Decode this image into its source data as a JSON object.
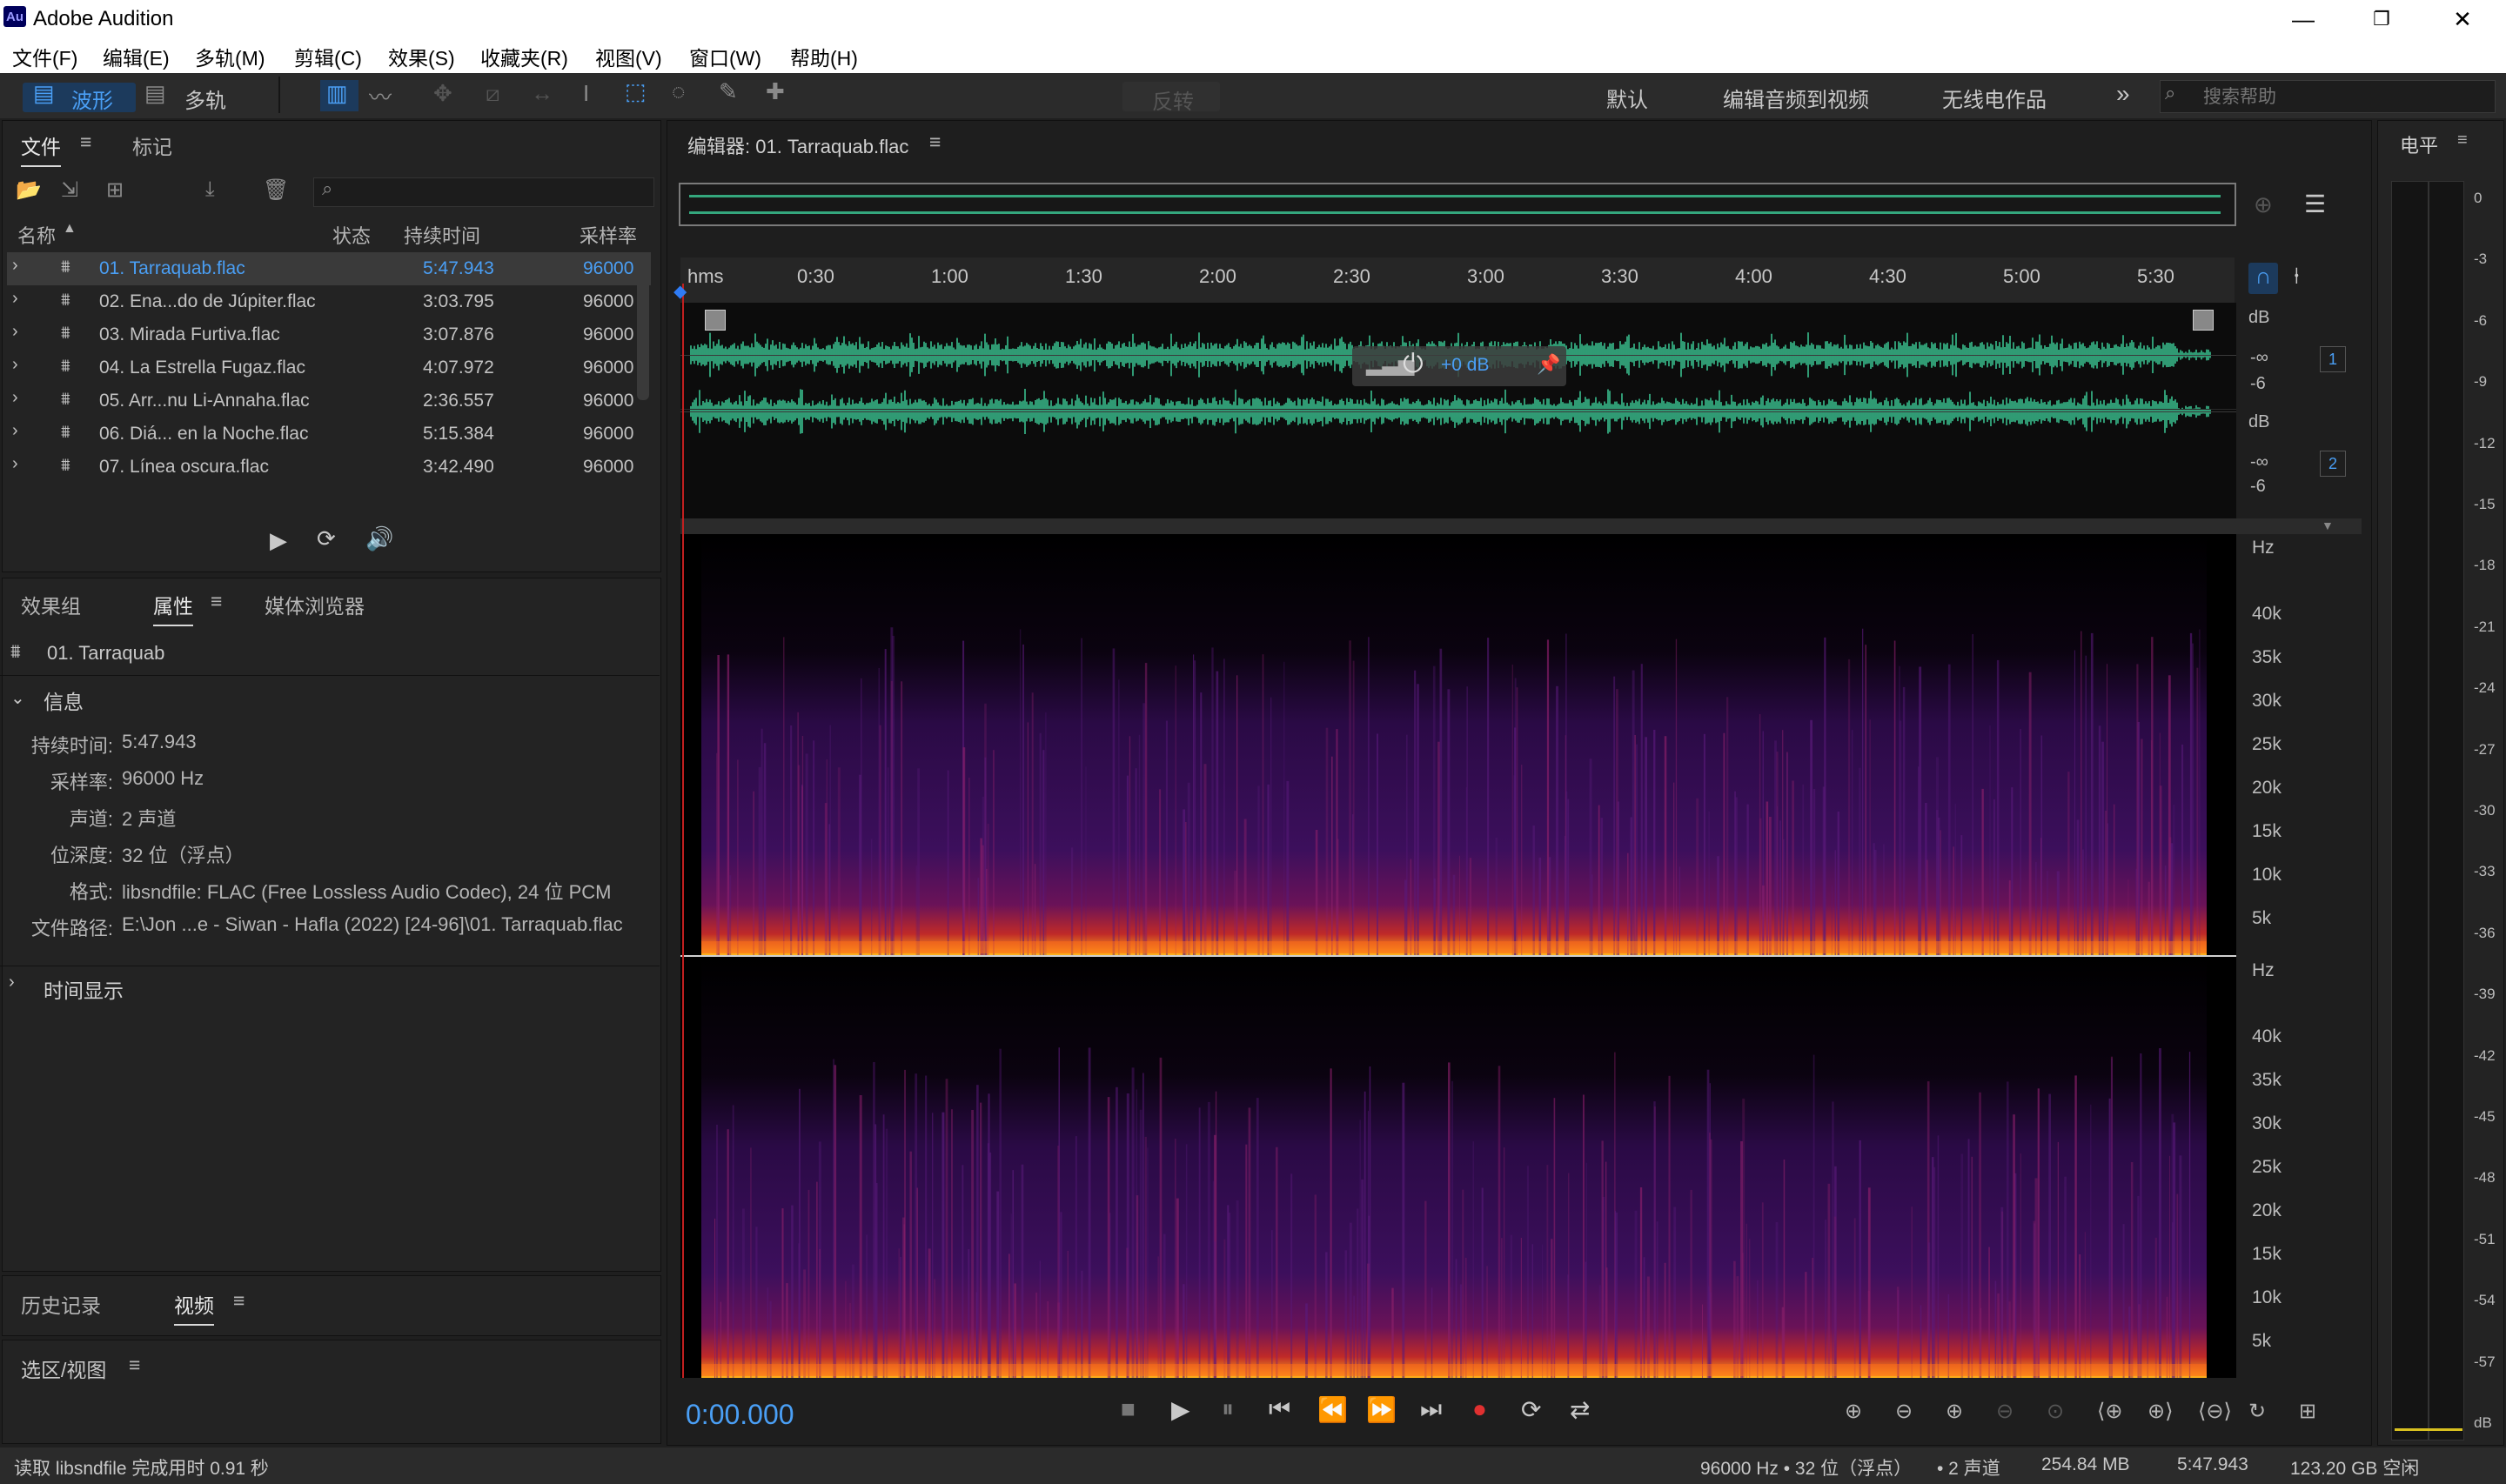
{
  "app": {
    "logo": "Au",
    "title": "Adobe Audition"
  },
  "window_controls": {
    "minimize": "—",
    "restore": "❐",
    "close": "✕"
  },
  "menu": [
    "文件(F)",
    "编辑(E)",
    "多轨(M)",
    "剪辑(C)",
    "效果(S)",
    "收藏夹(R)",
    "视图(V)",
    "窗口(W)",
    "帮助(H)"
  ],
  "toolbar": {
    "waveform_label": "波形",
    "multitrack_label": "多轨",
    "invert_label": "反转",
    "workspaces": [
      "默认",
      "编辑音频到视频",
      "无线电作品"
    ],
    "more": "»",
    "search_placeholder": "搜索帮助"
  },
  "files_panel": {
    "tabs": [
      "文件",
      "标记"
    ],
    "columns": {
      "name": "名称",
      "status": "状态",
      "duration": "持续时间",
      "rate": "采样率"
    },
    "rows": [
      {
        "name": "01. Tarraquab.flac",
        "duration": "5:47.943",
        "rate": "96000"
      },
      {
        "name": "02. Ena...do de Júpiter.flac",
        "duration": "3:03.795",
        "rate": "96000"
      },
      {
        "name": "03. Mirada Furtiva.flac",
        "duration": "3:07.876",
        "rate": "96000"
      },
      {
        "name": "04. La Estrella Fugaz.flac",
        "duration": "4:07.972",
        "rate": "96000"
      },
      {
        "name": "05. Arr...nu Li-Annaha.flac",
        "duration": "2:36.557",
        "rate": "96000"
      },
      {
        "name": "06. Diá... en la Noche.flac",
        "duration": "5:15.384",
        "rate": "96000"
      },
      {
        "name": "07. Línea oscura.flac",
        "duration": "3:42.490",
        "rate": "96000"
      }
    ]
  },
  "props_panel": {
    "tabs": [
      "效果组",
      "属性",
      "媒体浏览器"
    ],
    "clip_name": "01. Tarraquab",
    "info_header": "信息",
    "info": [
      {
        "label": "持续时间:",
        "value": "5:47.943"
      },
      {
        "label": "采样率:",
        "value": "96000 Hz"
      },
      {
        "label": "声道:",
        "value": "2 声道"
      },
      {
        "label": "位深度:",
        "value": "32 位（浮点）"
      },
      {
        "label": "格式:",
        "value": "libsndfile: FLAC (Free Lossless Audio Codec), 24 位 PCM"
      },
      {
        "label": "文件路径:",
        "value": "E:\\Jon ...e - Siwan - Hafla (2022) [24-96]\\01. Tarraquab.flac"
      }
    ],
    "time_display": "时间显示"
  },
  "history_panel": {
    "tabs": [
      "历史记录",
      "视频"
    ]
  },
  "selection_panel": {
    "title": "选区/视图"
  },
  "editor": {
    "title": "编辑器: 01. Tarraquab.flac",
    "ruler": [
      "hms",
      "0:30",
      "1:00",
      "1:30",
      "2:00",
      "2:30",
      "3:00",
      "3:30",
      "4:00",
      "4:30",
      "5:00",
      "5:30"
    ],
    "hud_gain": "+0 dB",
    "db_unit": "dB",
    "db_ticks": [
      "-∞",
      "-6"
    ],
    "channels": [
      "1",
      "2"
    ],
    "hz_unit": "Hz",
    "hz_ticks": [
      "40k",
      "35k",
      "30k",
      "25k",
      "20k",
      "15k",
      "10k",
      "5k"
    ],
    "timecode": "0:00.000"
  },
  "meter": {
    "title": "电平",
    "ticks": [
      "0",
      "-3",
      "-6",
      "-9",
      "-12",
      "-15",
      "-18",
      "-21",
      "-24",
      "-27",
      "-30",
      "-33",
      "-36",
      "-39",
      "-42",
      "-45",
      "-48",
      "-51",
      "-54",
      "-57",
      "dB"
    ]
  },
  "status": {
    "left": "读取 libsndfile 完成用时 0.91 秒",
    "rate": "96000 Hz • 32 位（浮点）",
    "channels": "• 2 声道",
    "size": "254.84 MB",
    "duration": "5:47.943",
    "free": "123.20 GB 空闲"
  },
  "colors": {
    "accent": "#4a9ff5",
    "waveform": "#3fd8a0",
    "playhead": "#2f7cf6",
    "record": "#e03030"
  }
}
